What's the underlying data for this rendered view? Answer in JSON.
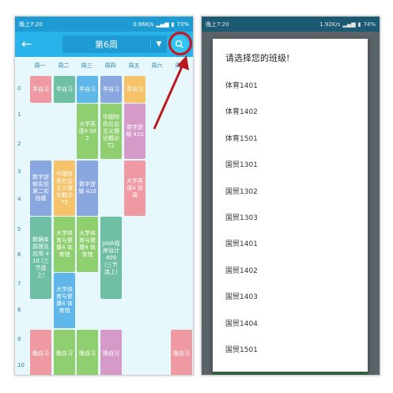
{
  "left": {
    "status": {
      "time": "晚上7:20",
      "speed": "0.86K/s",
      "battery": "73%"
    },
    "week_label": "第6周",
    "days": [
      "周一",
      "周二",
      "周三",
      "周四",
      "周五",
      "周六",
      "周日"
    ],
    "periods": [
      "0",
      "1",
      "2",
      "3",
      "4",
      "5",
      "6",
      "7",
      "8",
      "9",
      "10"
    ],
    "courses": [
      {
        "text": "早自习"
      },
      {
        "text": "早自习"
      },
      {
        "text": "早自习"
      },
      {
        "text": "早自习"
      },
      {
        "text": "早自习"
      },
      {
        "text": "大学英语4 502"
      },
      {
        "text": "中国特色社会主义理论概论T2"
      },
      {
        "text": "数字逻辑 410"
      },
      {
        "text": "数字逻辑实验第二实验楼"
      },
      {
        "text": "中国特色社会主义理论概论T3"
      },
      {
        "text": "数字逻辑 410"
      },
      {
        "text": "大学英语4 双周"
      },
      {
        "text": "数据库原理及应用 410 (三节连上)"
      },
      {
        "text": "大学体育与健康4 体育馆"
      },
      {
        "text": "大学体育与健康4 体育馆"
      },
      {
        "text": "JAVA程序设计 409 (三节连上)"
      },
      {
        "text": "大学体育与健康4 体育馆"
      },
      {
        "text": "晚自习"
      },
      {
        "text": "晚自习"
      },
      {
        "text": "晚自习"
      },
      {
        "text": "晚自习"
      },
      {
        "text": "晚自习"
      }
    ],
    "colors": {
      "pink": "#ef9aa2",
      "green": "#8fcf6f",
      "teal": "#6ebfa3",
      "blue": "#8aa6de",
      "purple": "#d59ac8",
      "orange": "#f6c36a",
      "sky": "#5fb6e8",
      "appbar": "#27b3ea"
    }
  },
  "right": {
    "status": {
      "time": "晚上7:20",
      "speed": "1.92K/s",
      "battery": "74%"
    },
    "dialog_title": "请选择您的班级!",
    "classes": [
      "体育1401",
      "体育1402",
      "体育1501",
      "国贸1301",
      "国贸1302",
      "国贸1303",
      "国贸1401",
      "国贸1402",
      "国贸1403",
      "国贸1404",
      "国贸1501"
    ]
  }
}
